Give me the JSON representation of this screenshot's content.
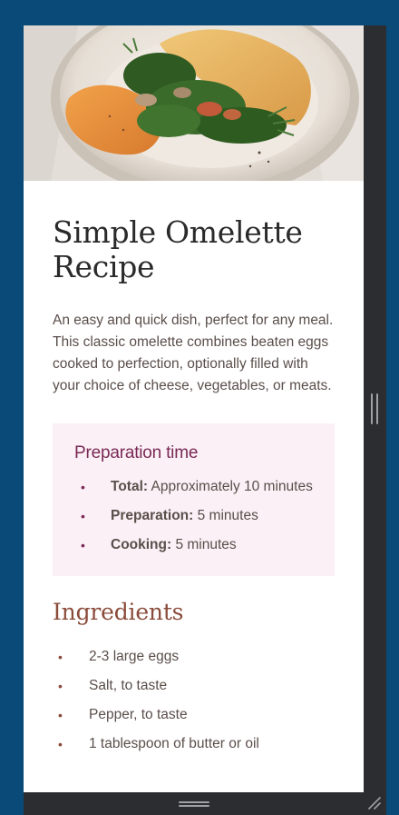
{
  "recipe": {
    "title": "Simple Omelette Recipe",
    "intro": "An easy and quick dish, perfect for any meal. This classic omelette combines beaten eggs cooked to perfection, optionally filled with your choice of cheese, vegetables, or meats.",
    "preparation": {
      "heading": "Preparation time",
      "items": [
        {
          "label": "Total:",
          "value": " Approximately 10 minutes"
        },
        {
          "label": "Preparation:",
          "value": " 5 minutes"
        },
        {
          "label": "Cooking:",
          "value": " 5 minutes"
        }
      ]
    },
    "ingredients": {
      "heading": "Ingredients",
      "items": [
        "2-3 large eggs",
        "Salt, to taste",
        "Pepper, to taste",
        "1 tablespoon of butter or oil"
      ]
    }
  },
  "bullet": "•",
  "colors": {
    "background": "#0a4a78",
    "device_chrome": "#2b2d31",
    "prep_box": "#fbf0f6",
    "prep_heading": "#7a2a55",
    "ingredients_heading": "#8a4b3a",
    "body_text": "#5a4e4a",
    "title_text": "#2a2a2a"
  },
  "icons": {
    "side_handle": "vertical-drag-handle-icon",
    "bottom_handle": "horizontal-drag-handle-icon",
    "resize_corner": "resize-corner-icon"
  }
}
